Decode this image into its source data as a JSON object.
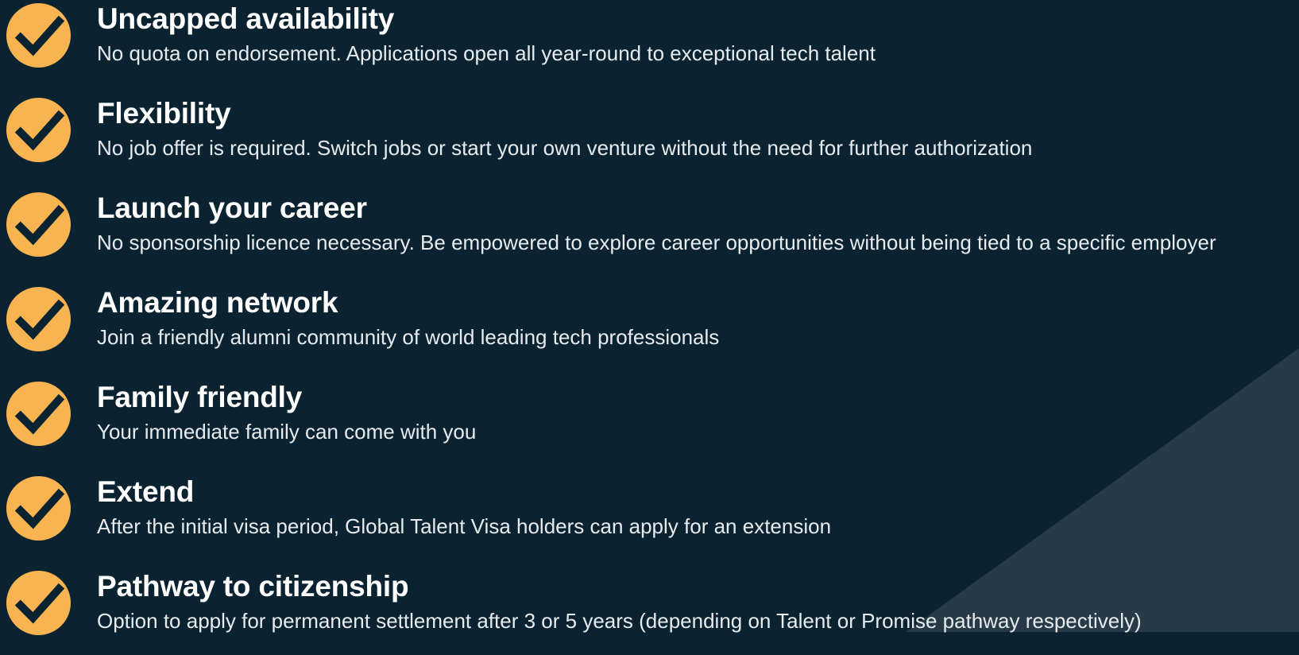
{
  "theme": {
    "background": "#0b2230",
    "accent_triangle": "#273a47",
    "check_circle": "#f7b451",
    "check_mark": "#0b2230",
    "text": "#ffffff"
  },
  "benefits": [
    {
      "icon": "check-circle-icon",
      "title": "Uncapped availability",
      "description": "No quota on endorsement. Applications open all year-round to exceptional tech talent"
    },
    {
      "icon": "check-circle-icon",
      "title": "Flexibility",
      "description": "No job offer is required. Switch jobs or start your own venture without the need for further authorization"
    },
    {
      "icon": "check-circle-icon",
      "title": "Launch your career",
      "description": "No sponsorship licence necessary. Be empowered to explore career opportunities without being tied to a specific employer"
    },
    {
      "icon": "check-circle-icon",
      "title": "Amazing network",
      "description": "Join a friendly alumni community of world leading tech professionals"
    },
    {
      "icon": "check-circle-icon",
      "title": "Family friendly",
      "description": "Your immediate family can come with you"
    },
    {
      "icon": "check-circle-icon",
      "title": "Extend",
      "description": "After the initial visa period, Global Talent Visa holders can apply for an extension"
    },
    {
      "icon": "check-circle-icon",
      "title": "Pathway to citizenship",
      "description": "Option to apply for permanent settlement after 3 or 5 years (depending on Talent or Promise pathway respectively)"
    }
  ]
}
